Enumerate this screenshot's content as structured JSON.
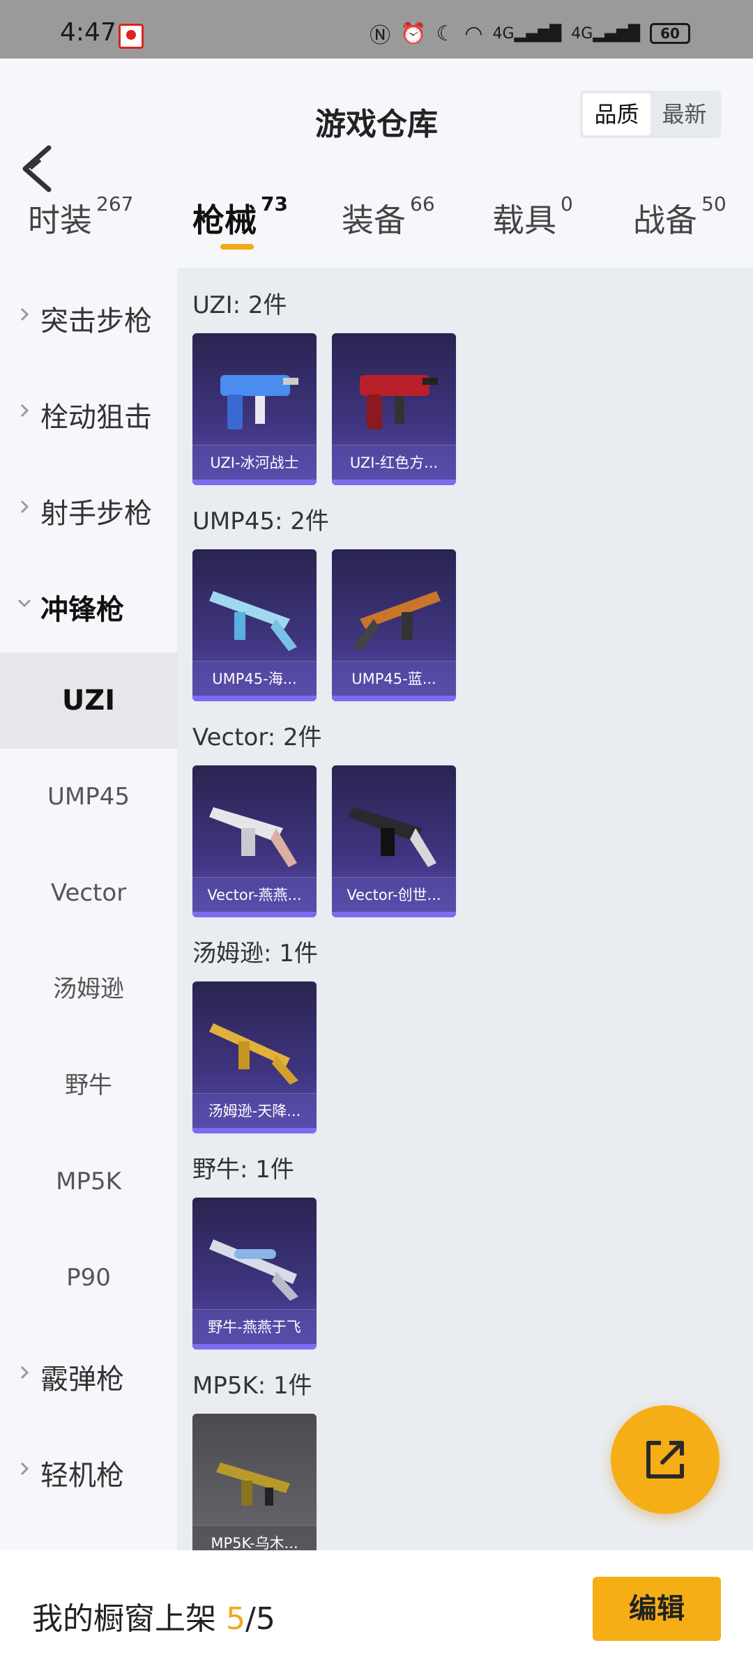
{
  "status_bar": {
    "time": "4:47",
    "battery": "60",
    "network_1": "4G",
    "network_2": "4G"
  },
  "header": {
    "title": "游戏仓库",
    "sort_options": [
      "品质",
      "最新"
    ],
    "sort_selected": "品质"
  },
  "tabs": [
    {
      "label": "时装",
      "count": "267"
    },
    {
      "label": "枪械",
      "count": "73"
    },
    {
      "label": "装备",
      "count": "66"
    },
    {
      "label": "载具",
      "count": "0"
    },
    {
      "label": "战备",
      "count": "50"
    }
  ],
  "sidebar": {
    "categories": [
      "突击步枪",
      "栓动狙击",
      "射手步枪",
      "冲锋枪",
      "霰弹枪",
      "轻机枪"
    ],
    "expanded": "冲锋枪",
    "subitems": [
      "UZI",
      "UMP45",
      "Vector",
      "汤姆逊",
      "野牛",
      "MP5K",
      "P90"
    ],
    "selected": "UZI"
  },
  "groups": [
    {
      "title": "UZI: 2件",
      "items": [
        "UZI-冰河战士",
        "UZI-红色方..."
      ]
    },
    {
      "title": "UMP45: 2件",
      "items": [
        "UMP45-海...",
        "UMP45-蓝..."
      ]
    },
    {
      "title": "Vector: 2件",
      "items": [
        "Vector-燕燕...",
        "Vector-创世..."
      ]
    },
    {
      "title": "汤姆逊: 1件",
      "items": [
        "汤姆逊-天降..."
      ]
    },
    {
      "title": "野牛: 1件",
      "items": [
        "野牛-燕燕于飞"
      ]
    },
    {
      "title": "MP5K: 1件",
      "items": [
        "MP5K-乌木..."
      ]
    }
  ],
  "footer": {
    "label": "我的橱窗上架 ",
    "current": "5",
    "separator": "/",
    "total": "5",
    "edit_label": "编辑"
  },
  "colors": {
    "accent": "#f6ae17",
    "card_purple": "#3f3580",
    "card_gray": "#5a5a60"
  }
}
